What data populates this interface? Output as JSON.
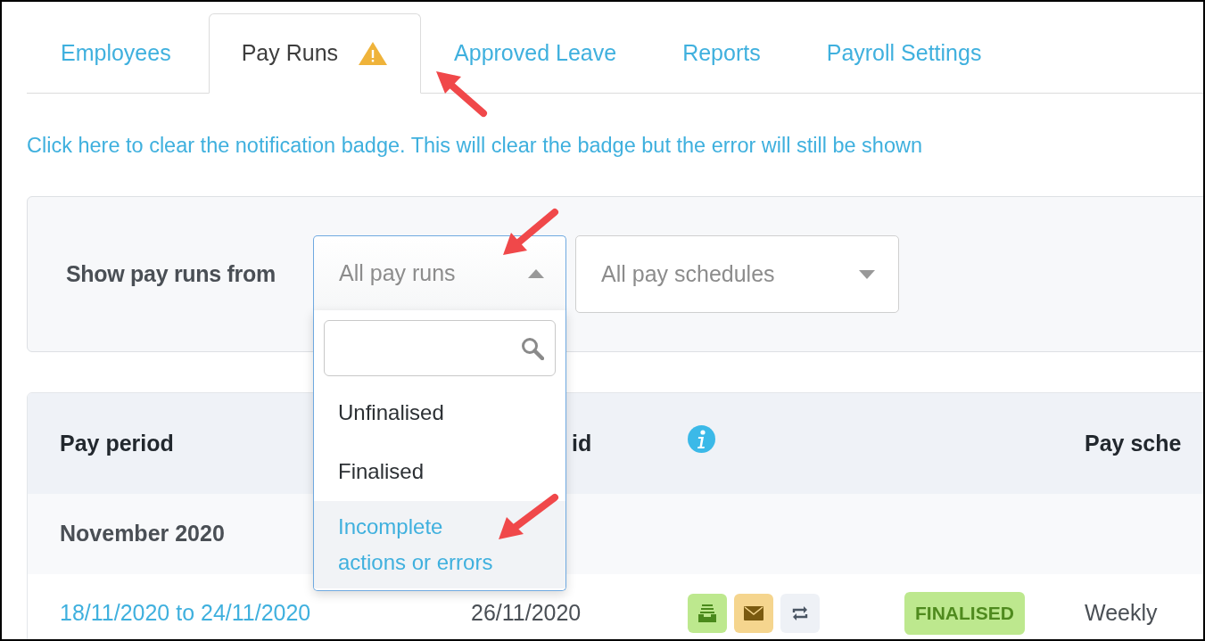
{
  "tabs": [
    {
      "label": "Employees",
      "selected": false,
      "warning": false
    },
    {
      "label": "Pay Runs",
      "selected": true,
      "warning": true
    },
    {
      "label": "Approved Leave",
      "selected": false,
      "warning": false
    },
    {
      "label": "Reports",
      "selected": false,
      "warning": false
    },
    {
      "label": "Payroll Settings",
      "selected": false,
      "warning": false
    }
  ],
  "notice_link": "Click here to clear the notification badge. This will clear the badge but the error will still be shown",
  "filter": {
    "label": "Show pay runs from",
    "status_select": {
      "value": "All pay runs",
      "expanded": true
    },
    "options": [
      {
        "label": "Unfinalised",
        "highlighted": false
      },
      {
        "label": "Finalised",
        "highlighted": false
      },
      {
        "label": "Incomplete actions or errors",
        "highlighted": true
      }
    ],
    "schedule_select": {
      "value": "All pay schedules",
      "expanded": false
    }
  },
  "table": {
    "columns": [
      {
        "kind": "text",
        "label": "Pay period"
      },
      {
        "kind": "text",
        "label": "id"
      },
      {
        "kind": "info"
      },
      {
        "kind": "blank"
      },
      {
        "kind": "text",
        "label": "Pay sche"
      }
    ],
    "groups": [
      {
        "title": "November 2020",
        "rows": [
          {
            "period": "18/11/2020 to 24/11/2020",
            "date_paid": "26/11/2020",
            "actions": [
              {
                "kind": "archive"
              },
              {
                "kind": "email"
              },
              {
                "kind": "sync"
              }
            ],
            "status": "FINALISED",
            "schedule": "Weekly"
          }
        ]
      }
    ]
  }
}
